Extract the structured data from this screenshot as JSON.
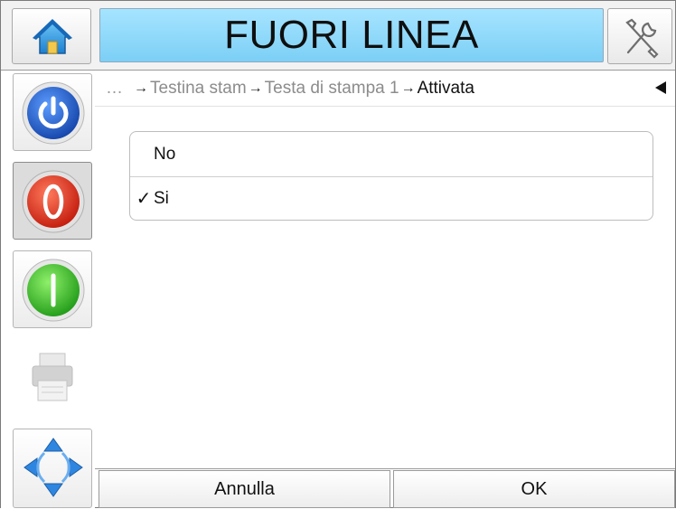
{
  "header": {
    "status_text": "FUORI LINEA",
    "home_icon": "home-icon",
    "tools_icon": "tools-icon"
  },
  "sidebar": {
    "buttons": [
      {
        "name": "power-icon",
        "color": "#1f5bd0"
      },
      {
        "name": "stop-icon",
        "color": "#e0301c"
      },
      {
        "name": "start-icon",
        "color": "#2fbf2a"
      },
      {
        "name": "printer-icon",
        "color": "#bdbdbd"
      },
      {
        "name": "navigate-arrows-icon",
        "color": "#2f86e0"
      }
    ]
  },
  "breadcrumb": {
    "ellipsis": "…",
    "items": [
      "Testina stam",
      "Testa di stampa 1"
    ],
    "current": "Attivata",
    "separator": "→"
  },
  "options": {
    "items": [
      {
        "label": "No",
        "checked": false
      },
      {
        "label": "Si",
        "checked": true
      }
    ],
    "checkmark": "✓"
  },
  "footer": {
    "cancel_label": "Annulla",
    "ok_label": "OK"
  }
}
